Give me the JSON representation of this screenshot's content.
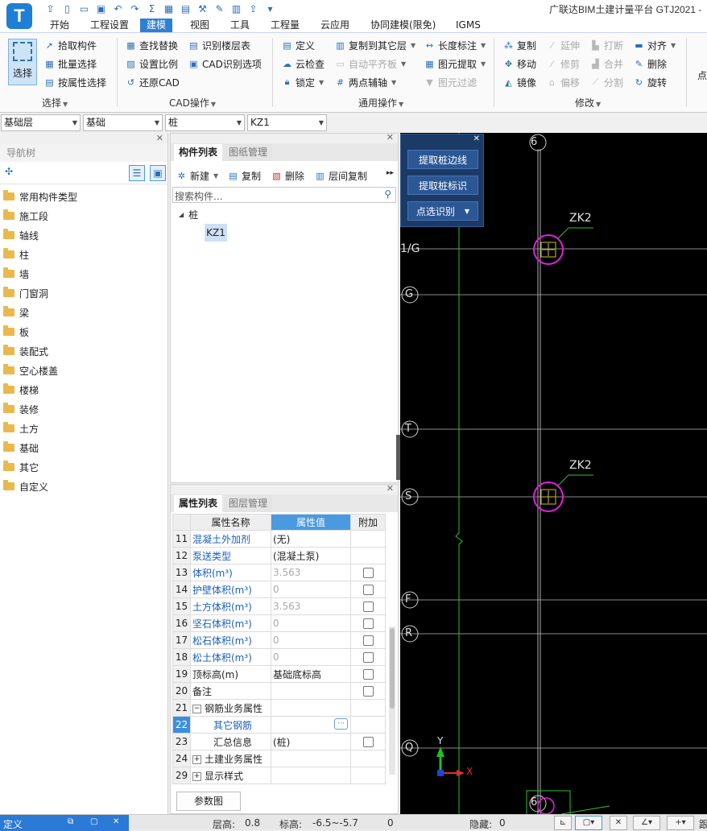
{
  "app": {
    "logo": "T",
    "title": "广联达BIM土建计量平台 GTJ2021 -"
  },
  "menu": {
    "tabs": [
      "开始",
      "工程设置",
      "建模",
      "视图",
      "工具",
      "工程量",
      "云应用",
      "协同建模(限免)",
      "IGMS"
    ],
    "active": "建模"
  },
  "ribbon": {
    "select_group": {
      "big_button": "选择",
      "buttons": [
        "拾取构件",
        "批量选择",
        "按属性选择"
      ],
      "label": "选择"
    },
    "cad_group": {
      "buttons": [
        "查找替换",
        "识别楼层表",
        "设置比例",
        "CAD识别选项",
        "还原CAD"
      ],
      "label": "CAD操作"
    },
    "general_group": {
      "buttons": [
        "定义",
        "复制到其它层",
        "长度标注",
        "云检查",
        "自动平齐板",
        "图元提取",
        "锁定",
        "两点辅轴",
        "图元过滤"
      ],
      "label": "通用操作"
    },
    "modify_group": {
      "buttons": [
        "复制",
        "延伸",
        "打断",
        "对齐",
        "移动",
        "修剪",
        "合并",
        "删除",
        "镜像",
        "偏移",
        "分割",
        "旋转"
      ],
      "label": "修改"
    },
    "overflow": "点"
  },
  "combos": {
    "floor": "基础层",
    "category": "基础",
    "type": "桩",
    "component": "KZ1"
  },
  "nav": {
    "title": "导航树",
    "items": [
      "常用构件类型",
      "施工段",
      "轴线",
      "柱",
      "墙",
      "门窗洞",
      "梁",
      "板",
      "装配式",
      "空心楼盖",
      "楼梯",
      "装修",
      "土方",
      "基础",
      "其它",
      "自定义"
    ]
  },
  "components": {
    "tabs": [
      "构件列表",
      "图纸管理"
    ],
    "toolbar": [
      "新建",
      "复制",
      "删除",
      "层间复制"
    ],
    "search_placeholder": "搜索构件...",
    "tree_parent": "桩",
    "tree_child": "KZ1"
  },
  "properties": {
    "tabs": [
      "属性列表",
      "图层管理"
    ],
    "headers": [
      "属性名称",
      "属性值",
      "附加"
    ],
    "rows": [
      {
        "n": "11",
        "name": "混凝土外加剂",
        "value": "(无)",
        "check": false
      },
      {
        "n": "12",
        "name": "泵送类型",
        "value": "(混凝土泵)",
        "check": false
      },
      {
        "n": "13",
        "name": "体积(m³)",
        "value": "3.563",
        "check": true
      },
      {
        "n": "14",
        "name": "护壁体积(m³)",
        "value": "0",
        "check": true
      },
      {
        "n": "15",
        "name": "土方体积(m³)",
        "value": "3.563",
        "check": true
      },
      {
        "n": "16",
        "name": "坚石体积(m³)",
        "value": "0",
        "check": true
      },
      {
        "n": "17",
        "name": "松石体积(m³)",
        "value": "0",
        "check": true
      },
      {
        "n": "18",
        "name": "松土体积(m³)",
        "value": "0",
        "check": true
      },
      {
        "n": "19",
        "name": "顶标高(m)",
        "value": "基础底标高",
        "check": true
      },
      {
        "n": "20",
        "name": "备注",
        "value": "",
        "check": true
      },
      {
        "n": "21",
        "name": "钢筋业务属性",
        "value": "",
        "check": false
      },
      {
        "n": "22",
        "name": "其它钢筋",
        "value": "",
        "check": false
      },
      {
        "n": "23",
        "name": "汇总信息",
        "value": "(桩)",
        "check": true
      },
      {
        "n": "24",
        "name": "土建业务属性",
        "value": "",
        "check": false
      },
      {
        "n": "29",
        "name": "显示样式",
        "value": "",
        "check": false
      }
    ],
    "param_button": "参数图"
  },
  "float_panel": {
    "buttons": [
      "提取桩边线",
      "提取桩标识",
      "点选识别"
    ]
  },
  "canvas": {
    "axis_top": "6",
    "axis_bottom": "6",
    "axis_left_top": "1/G",
    "axes_left": [
      "G",
      "T",
      "S",
      "F",
      "R",
      "Q"
    ],
    "pile_label": "ZK2",
    "ucs_y": "Y",
    "ucs_x": "X"
  },
  "status": {
    "left_label": "定义",
    "floor_height_label": "层高:",
    "floor_height": "0.8",
    "elevation_label": "标高:",
    "elevation": "-6.5~-5.7",
    "count": "0",
    "hidden_label": "隐藏:",
    "hidden": "0",
    "overflow": "跟"
  }
}
